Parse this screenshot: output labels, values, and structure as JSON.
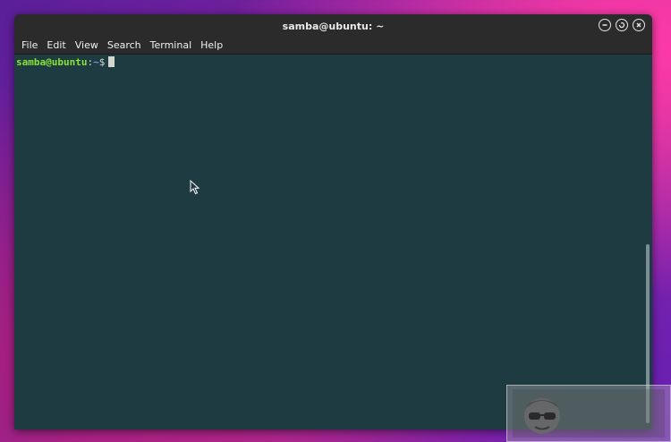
{
  "window": {
    "title": "samba@ubuntu: ~"
  },
  "menu": {
    "items": [
      "File",
      "Edit",
      "View",
      "Search",
      "Terminal",
      "Help"
    ]
  },
  "terminal": {
    "user_host": "samba@ubuntu",
    "separator": ":",
    "path": "~",
    "symbol": "$"
  },
  "icons": {
    "minimize": "minimize-icon",
    "restore": "restore-icon",
    "close": "close-icon",
    "pointer": "mouse-pointer-icon",
    "watermark_logo": "avatar-sunglasses-logo"
  },
  "colors": {
    "terminal_bg": "#1f3b42",
    "titlebar_bg": "#2b2b2b",
    "prompt_user": "#8ae234",
    "prompt_path": "#729fcf"
  }
}
